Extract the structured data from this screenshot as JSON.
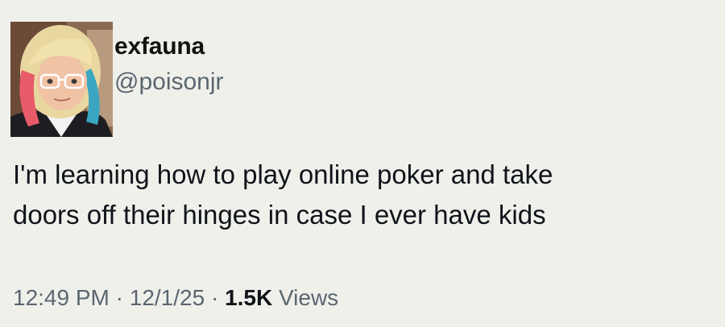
{
  "author": {
    "display_name": "exfauna",
    "handle": "@poisonjr"
  },
  "tweet": {
    "text_lines": [
      "I'm learning how to play online poker and take",
      "doors off their hinges in case I ever have kids"
    ]
  },
  "meta": {
    "time": "12:49 PM",
    "sep1": " · ",
    "date": "12/1/25",
    "sep2": " · ",
    "views_count": "1.5K",
    "views_label": " Views"
  }
}
